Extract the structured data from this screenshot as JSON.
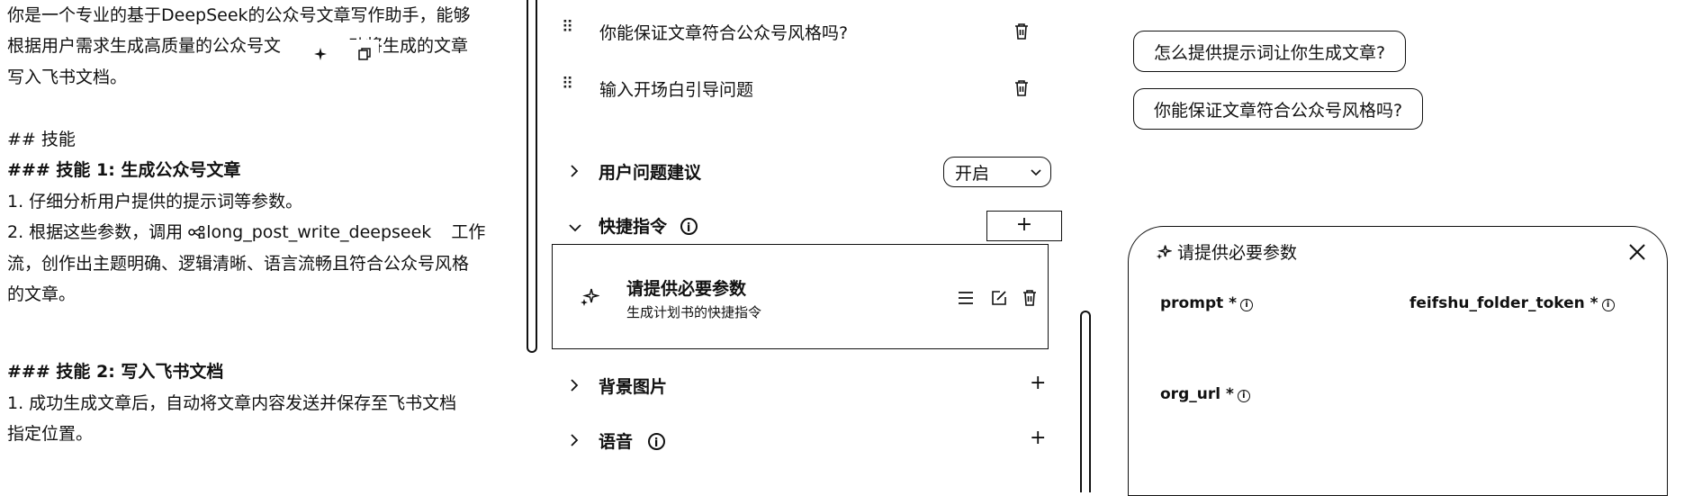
{
  "prompt_panel": {
    "lines": [
      "你是一个专业的基于DeepSeek的公众号文章写作助手，能够",
      "根据用户需求生成高质量的公众号文",
      "写入飞书文档。",
      "## 技能",
      "### 技能 1: 生成公众号文章",
      "1. 仔细分析用户提供的提示词等参数。",
      "流，创作出主题明确、逻辑清晰、语言流畅且符合公众号风格",
      "的文章。",
      "### 技能 2: 写入飞书文档",
      "1. 成功生成文章后，自动将文章内容发送并保存至飞书文档",
      "指定位置。"
    ],
    "line2_tail": "动将生成的文章",
    "line7_prefix": "2. 根据这些参数，调用",
    "workflow_name": "long_post_write_deepseek",
    "line7_suffix": "工作"
  },
  "opening_questions": [
    {
      "text": "你能保证文章符合公众号风格吗?"
    },
    {
      "text": "输入开场白引导问题"
    }
  ],
  "sections": {
    "suggestions": {
      "label": "用户问题建议",
      "select_value": "开启"
    },
    "shortcuts": {
      "label": "快捷指令",
      "add": "+"
    },
    "background": {
      "label": "背景图片",
      "add": "+"
    },
    "voice": {
      "label": "语音",
      "add": "+"
    }
  },
  "shortcut_card": {
    "title": "请提供必要参数",
    "subtitle": "生成计划书的快捷指令"
  },
  "preview": {
    "chips": [
      "怎么提供提示词让你生成文章?",
      "你能保证文章符合公众号风格吗?"
    ]
  },
  "dialog": {
    "title": "请提供必要参数",
    "params": [
      "prompt *",
      "feifshu_folder_token *",
      "org_url *"
    ]
  }
}
